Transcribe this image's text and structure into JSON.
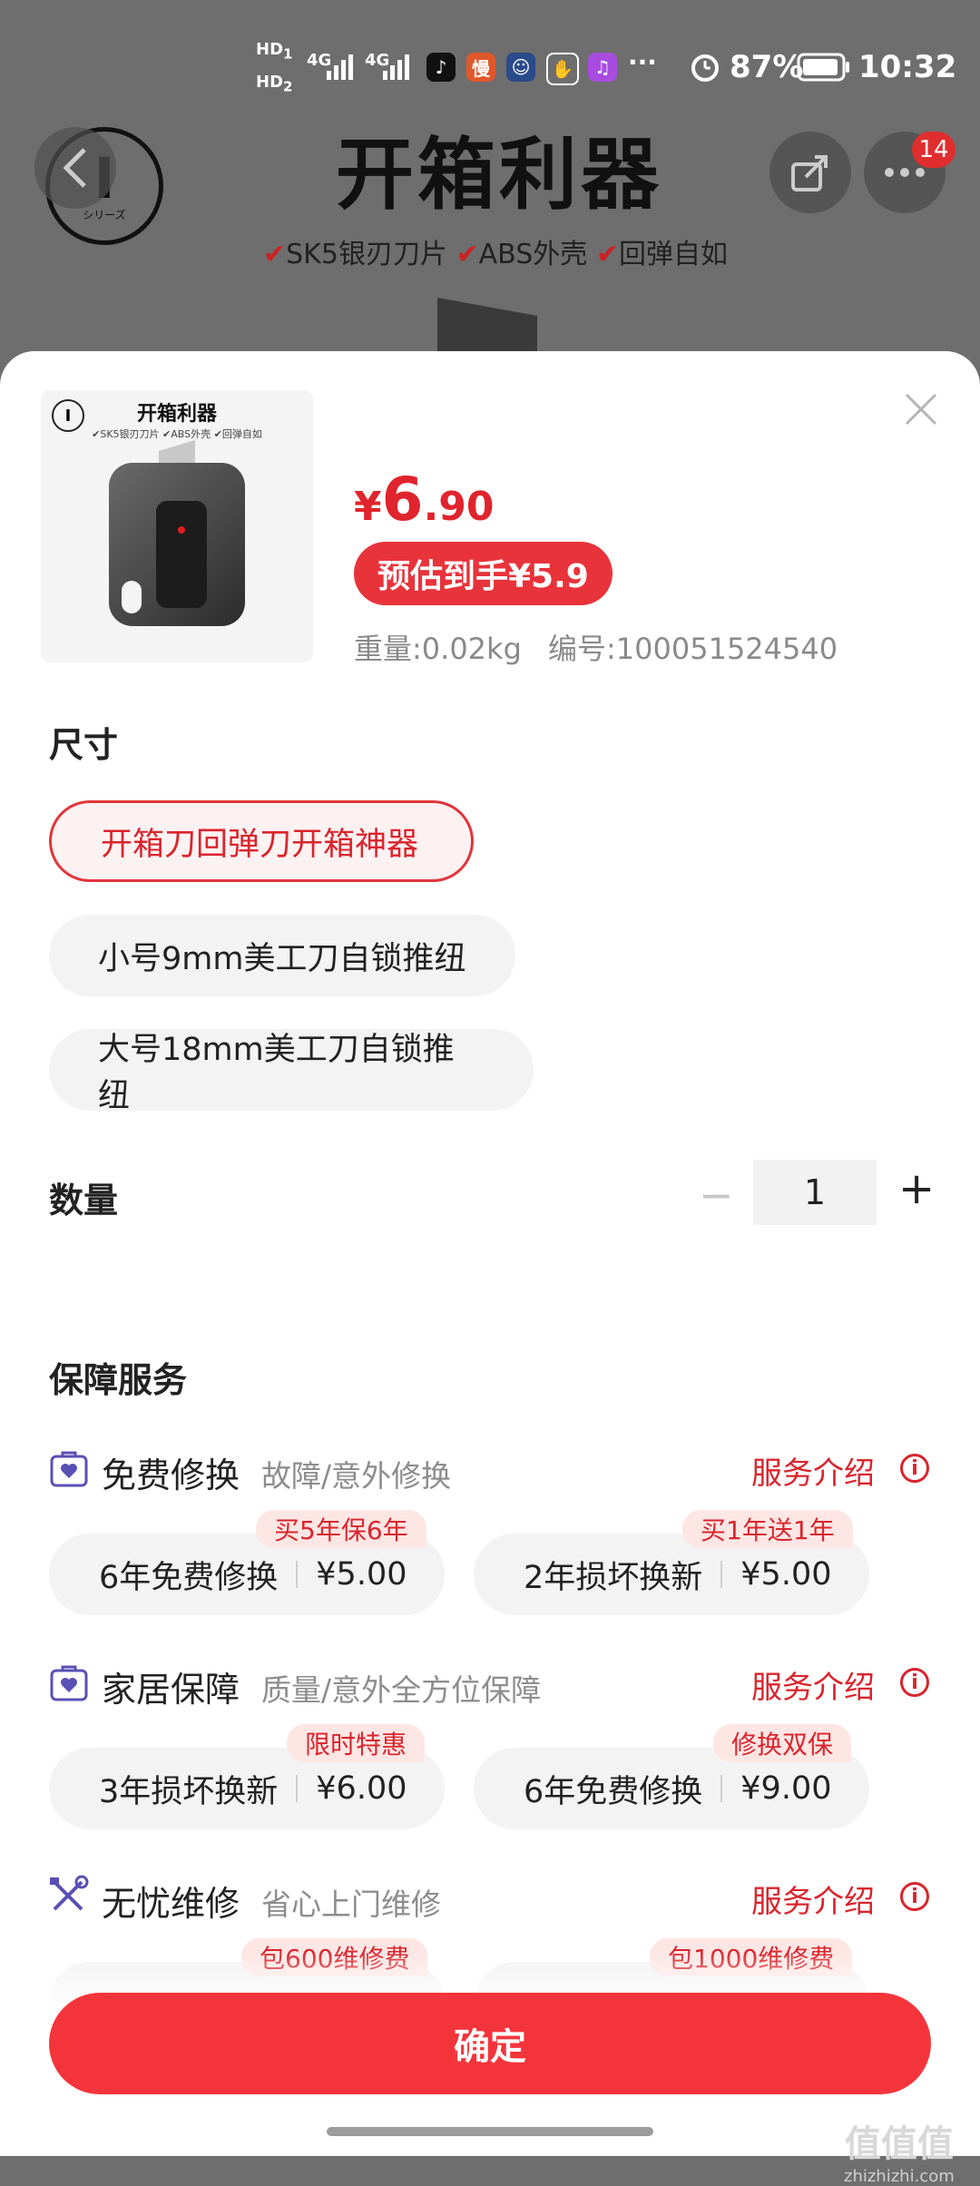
{
  "status_bar": {
    "hd1": "HD",
    "hd2": "HD",
    "sim1": "1",
    "sim2": "2",
    "net1": "4G",
    "net2": "4G",
    "more": "···",
    "battery": "87%",
    "time": "10:32"
  },
  "background": {
    "title": "开箱利器",
    "features": [
      "SK5银刃刀片",
      "ABS外壳",
      "回弹自如"
    ],
    "badge_count": "14",
    "logo_text": "シリーズ"
  },
  "product": {
    "thumb_title": "开箱利器",
    "thumb_features": "✔SK5银刃刀片 ✔ABS外壳 ✔回弹自如",
    "price_symbol": "¥",
    "price_int": "6",
    "price_dec": ".90",
    "estimated": "预估到手¥5.9",
    "weight": "重量:0.02kg",
    "sku": "编号:100051524540"
  },
  "size": {
    "label": "尺寸",
    "options": [
      "开箱刀回弹刀开箱神器",
      "小号9mm美工刀自锁推纽",
      "大号18mm美工刀自锁推纽"
    ]
  },
  "quantity": {
    "label": "数量",
    "minus": "−",
    "value": "1",
    "plus": "+"
  },
  "services": {
    "label": "保障服务",
    "groups": [
      {
        "name": "免费修换",
        "desc": "故障/意外修换",
        "link": "服务介绍",
        "options": [
          {
            "tag": "买5年保6年",
            "name": "6年免费修换",
            "price": "¥5.00"
          },
          {
            "tag": "买1年送1年",
            "name": "2年损坏换新",
            "price": "¥5.00"
          }
        ]
      },
      {
        "name": "家居保障",
        "desc": "质量/意外全方位保障",
        "link": "服务介绍",
        "options": [
          {
            "tag": "限时特惠",
            "name": "3年损坏换新",
            "price": "¥6.00"
          },
          {
            "tag": "修换双保",
            "name": "6年免费修换",
            "price": "¥9.00"
          }
        ]
      },
      {
        "name": "无忧维修",
        "desc": "省心上门维修",
        "link": "服务介绍",
        "options": [
          {
            "tag": "包600维修费"
          },
          {
            "tag": "包1000维修费"
          }
        ]
      }
    ]
  },
  "confirm_label": "确定",
  "watermark": {
    "logo": "值值值",
    "url": "zhizhizhi.com"
  },
  "colors": {
    "accent": "#e0242d",
    "button": "#f4343b"
  }
}
